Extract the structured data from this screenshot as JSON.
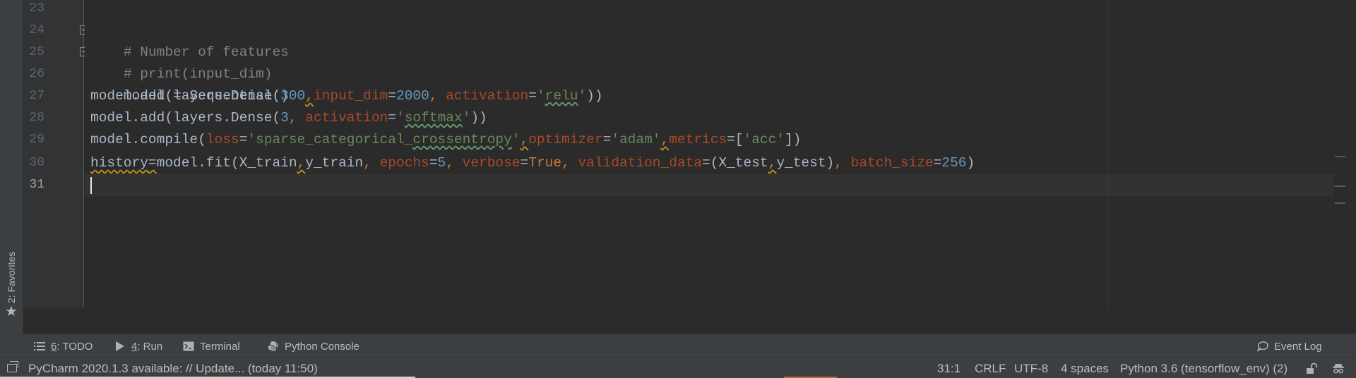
{
  "favorites": {
    "label": "2: Favorites",
    "icon": "star-icon"
  },
  "gutter": {
    "lines": [
      "23",
      "24",
      "25",
      "26",
      "27",
      "28",
      "29",
      "30",
      "31"
    ],
    "current_line": "31"
  },
  "code": {
    "l24_comment": "# Number of features",
    "l25_comment": "# print(input_dim)",
    "l26": "model = Sequential()",
    "l27": {
      "a": "model.add(layers.Dense(",
      "n1": "300",
      "comma": ",",
      "p1": "input_dim",
      "eq1": "=",
      "n2": "2000",
      "sep": ", ",
      "p2": "activation",
      "eq2": "=",
      "q1": "'",
      "s1": "relu",
      "q2": "'",
      "end": "))"
    },
    "l28": {
      "a": "model.add(layers.Dense(",
      "n1": "3",
      "sep": ", ",
      "p1": "activation",
      "eq1": "=",
      "q1": "'",
      "s1": "softmax",
      "q2": "'",
      "end": "))"
    },
    "l29": {
      "a": "model.compile(",
      "p1": "loss",
      "eq1": "=",
      "s1a": "'sparse_categorical_",
      "s1b": "crossentropy",
      "s1c": "'",
      "c1": ",",
      "p2": "optimizer",
      "eq2": "=",
      "s2": "'adam'",
      "c2": ",",
      "p3": "metrics",
      "eq3": "=[",
      "s3": "'acc'",
      "end": "])"
    },
    "l30": {
      "a": "history",
      "eq": "=",
      "b": "model.fit(X_train",
      "c1": ",",
      "d": "y_train",
      "sep1": ", ",
      "p1": "epochs",
      "eq1": "=",
      "n1": "5",
      "sep2": ", ",
      "p2": "verbose",
      "eq2": "=",
      "kw": "True",
      "sep3": ", ",
      "p3": "validation_data",
      "eq3": "=(X_test",
      "c2": ",",
      "e": "y_test)",
      "sep4": ", ",
      "p4": "batch_size",
      "eq4": "=",
      "n2": "256",
      "end": ")"
    }
  },
  "tool_windows": {
    "todo": {
      "num": "6",
      "label": ": TODO",
      "icon": "list-icon"
    },
    "run": {
      "num": "4",
      "label": ": Run",
      "icon": "play-icon"
    },
    "terminal": {
      "label": "Terminal",
      "icon": "terminal-icon"
    },
    "python_console": {
      "label": "Python Console",
      "icon": "python-icon"
    },
    "event_log": {
      "label": "Event Log",
      "icon": "speech-bubble-icon"
    }
  },
  "status": {
    "message": "PyCharm 2020.1.3 available: // Update... (today 11:50)",
    "position": "31:1",
    "line_sep": "CRLF",
    "encoding": "UTF-8",
    "indent": "4 spaces",
    "interpreter": "Python 3.6 (tensorflow_env) (2)",
    "lock_icon": "unlock-icon",
    "inspector_icon": "inspector-icon"
  },
  "colors": {
    "keyword": "#cc7832",
    "param": "#aa4926",
    "number": "#6897bb",
    "string": "#6a8759",
    "comment": "#808080"
  }
}
